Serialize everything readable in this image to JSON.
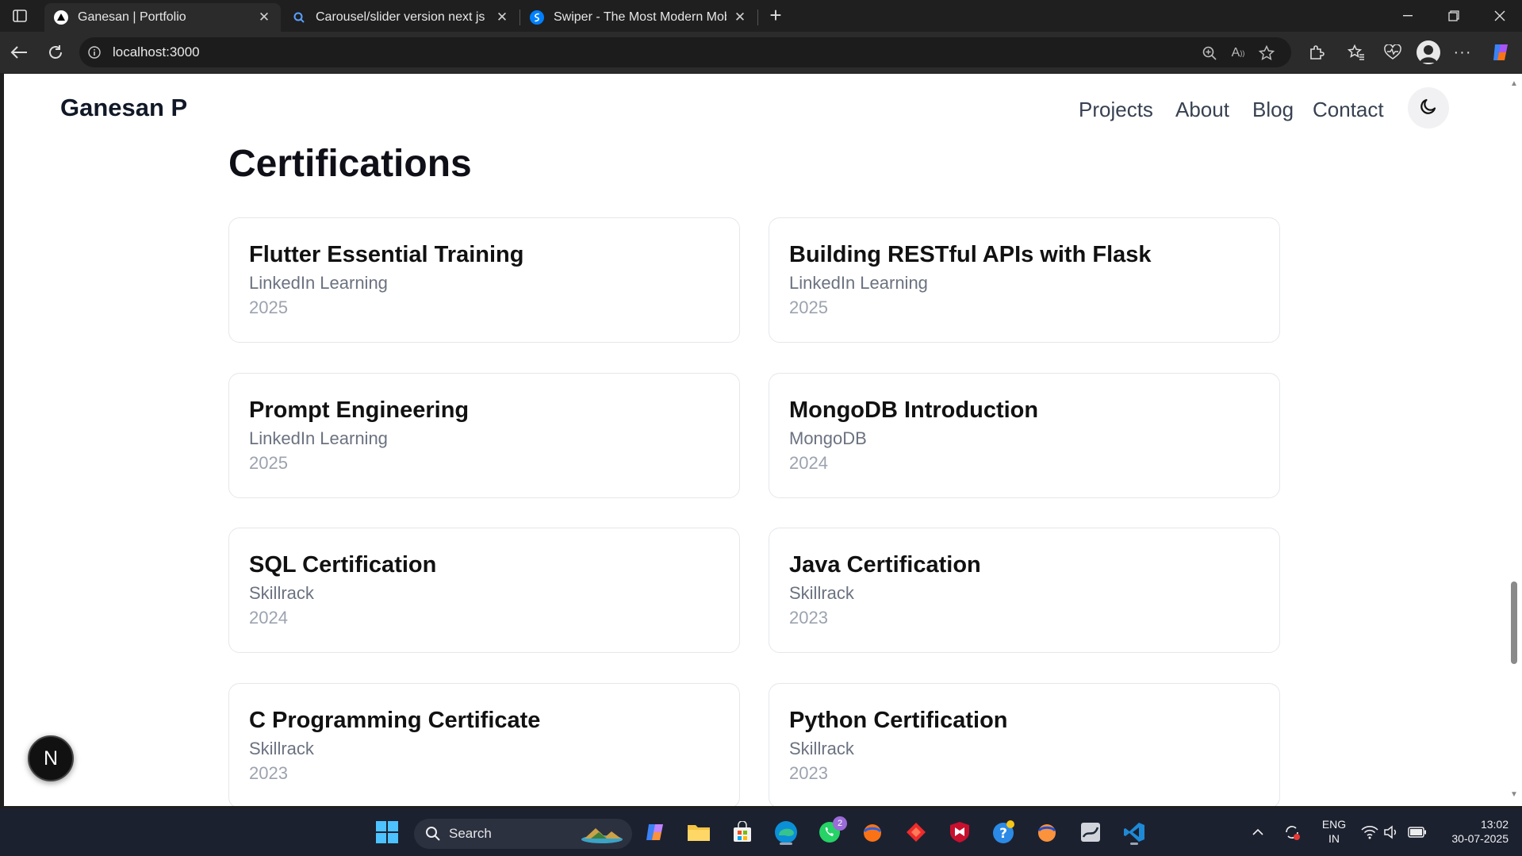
{
  "browser": {
    "tabs": [
      {
        "title": "Ganesan | Portfolio",
        "favicon": "triangle-logo-icon",
        "active": true
      },
      {
        "title": "Carousel/slider version next js - S",
        "favicon": "search-icon",
        "active": false
      },
      {
        "title": "Swiper - The Most Modern Mobil",
        "favicon": "swiper-logo-icon",
        "active": false
      }
    ],
    "url": "localhost:3000"
  },
  "page": {
    "brand": "Ganesan P",
    "nav": [
      "Projects",
      "About",
      "Blog",
      "Contact"
    ],
    "section_title": "Certifications",
    "certifications": [
      {
        "title": "Flutter Essential Training",
        "issuer": "LinkedIn Learning",
        "year": "2025"
      },
      {
        "title": "Building RESTful APIs with Flask",
        "issuer": "LinkedIn Learning",
        "year": "2025"
      },
      {
        "title": "Prompt Engineering",
        "issuer": "LinkedIn Learning",
        "year": "2025"
      },
      {
        "title": "MongoDB Introduction",
        "issuer": "MongoDB",
        "year": "2024"
      },
      {
        "title": "SQL Certification",
        "issuer": "Skillrack",
        "year": "2024"
      },
      {
        "title": "Java Certification",
        "issuer": "Skillrack",
        "year": "2023"
      },
      {
        "title": "C Programming Certificate",
        "issuer": "Skillrack",
        "year": "2023"
      },
      {
        "title": "Python Certification",
        "issuer": "Skillrack",
        "year": "2023"
      }
    ],
    "dev_badge": "N"
  },
  "taskbar": {
    "search_label": "Search",
    "whatsapp_badge": "2",
    "language": "ENG",
    "region": "IN",
    "time": "13:02",
    "date": "30-07-2025"
  },
  "colors": {
    "brand_text": "#111827",
    "card_border": "#e5e7eb",
    "muted_text": "#6b7280",
    "year_text": "#9ca3af"
  }
}
